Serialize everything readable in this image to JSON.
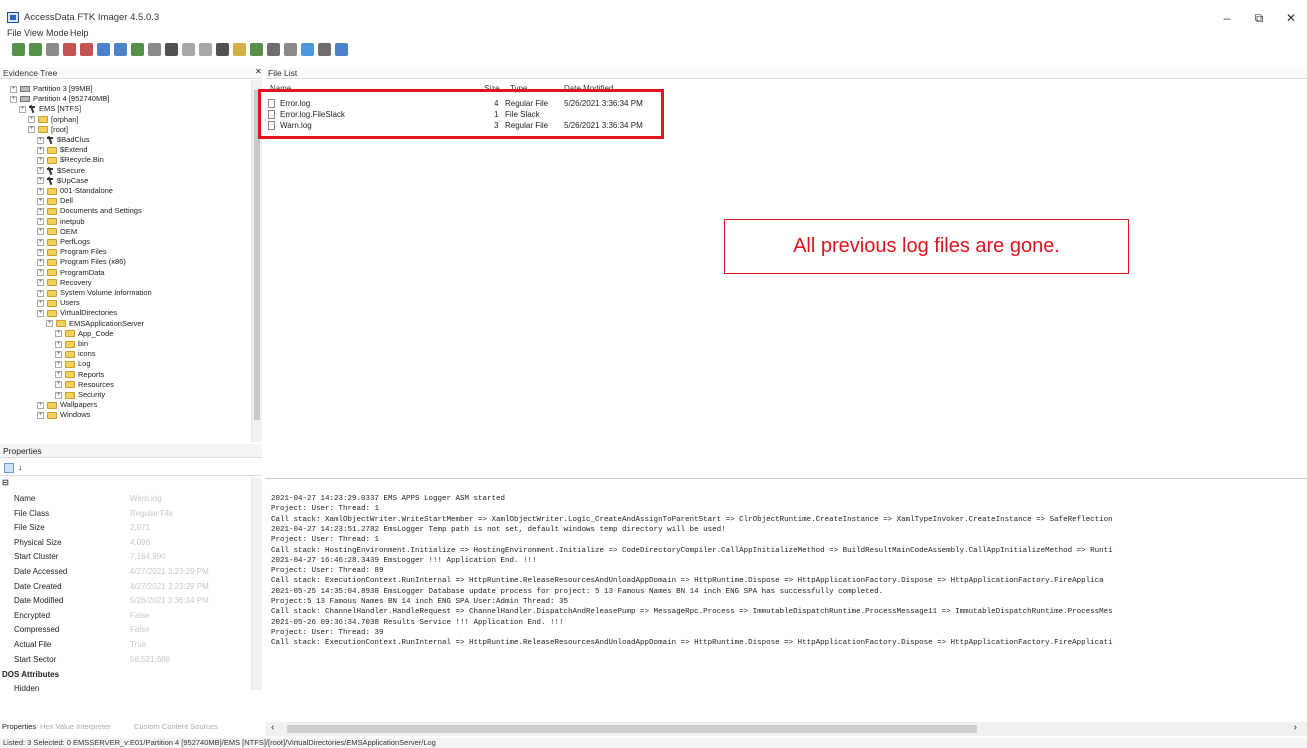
{
  "window": {
    "title": "AccessData FTK Imager 4.5.0.3",
    "minimize": "–",
    "restore": "⧉",
    "close": "✕"
  },
  "menu": [
    "File",
    "View",
    "Mode",
    "Help"
  ],
  "panels": {
    "evidence_tree_title": "Evidence Tree",
    "file_list_title": "File List",
    "properties_title": "Properties"
  },
  "tree": [
    {
      "label": "Partition 3 [99MB]",
      "kind": "drive",
      "indent": 0
    },
    {
      "label": "Partition 4 [952740MB]",
      "kind": "drive",
      "indent": 0
    },
    {
      "label": "EMS [NTFS]",
      "kind": "sys",
      "indent": 1
    },
    {
      "label": "[orphan]",
      "kind": "folder",
      "indent": 2
    },
    {
      "label": "[root]",
      "kind": "folder",
      "indent": 2
    },
    {
      "label": "$BadClus",
      "kind": "sys",
      "indent": 3
    },
    {
      "label": "$Extend",
      "kind": "folder",
      "indent": 3
    },
    {
      "label": "$Recycle.Bin",
      "kind": "folder",
      "indent": 3
    },
    {
      "label": "$Secure",
      "kind": "sys",
      "indent": 3
    },
    {
      "label": "$UpCase",
      "kind": "sys",
      "indent": 3
    },
    {
      "label": "001-Standalone",
      "kind": "folder",
      "indent": 3
    },
    {
      "label": "Dell",
      "kind": "folder",
      "indent": 3
    },
    {
      "label": "Documents and Settings",
      "kind": "folder",
      "indent": 3
    },
    {
      "label": "inetpub",
      "kind": "folder",
      "indent": 3
    },
    {
      "label": "OEM",
      "kind": "folder",
      "indent": 3
    },
    {
      "label": "PerfLogs",
      "kind": "folder",
      "indent": 3
    },
    {
      "label": "Program Files",
      "kind": "folder",
      "indent": 3
    },
    {
      "label": "Program Files (x86)",
      "kind": "folder",
      "indent": 3
    },
    {
      "label": "ProgramData",
      "kind": "folder",
      "indent": 3
    },
    {
      "label": "Recovery",
      "kind": "folder",
      "indent": 3
    },
    {
      "label": "System Volume Information",
      "kind": "folder",
      "indent": 3
    },
    {
      "label": "Users",
      "kind": "folder",
      "indent": 3
    },
    {
      "label": "VirtualDirectories",
      "kind": "folder",
      "indent": 3
    },
    {
      "label": "EMSApplicationServer",
      "kind": "folder",
      "indent": 4
    },
    {
      "label": "App_Code",
      "kind": "folder",
      "indent": 5
    },
    {
      "label": "bin",
      "kind": "folder",
      "indent": 5
    },
    {
      "label": "icons",
      "kind": "folder",
      "indent": 5
    },
    {
      "label": "Log",
      "kind": "folder",
      "indent": 5
    },
    {
      "label": "Reports",
      "kind": "folder",
      "indent": 5
    },
    {
      "label": "Resources",
      "kind": "folder",
      "indent": 5
    },
    {
      "label": "Security",
      "kind": "folder",
      "indent": 5
    },
    {
      "label": "Wallpapers",
      "kind": "folder",
      "indent": 3
    },
    {
      "label": "Windows",
      "kind": "folder",
      "indent": 3
    }
  ],
  "file_list": {
    "headers": {
      "name": "Name",
      "size": "Size",
      "type": "Type",
      "date": "Date Modified"
    },
    "rows": [
      {
        "name": "Error.log",
        "size": "4",
        "type": "Regular File",
        "date": "5/26/2021 3:36:34 PM"
      },
      {
        "name": "Error.log.FileSlack",
        "size": "1",
        "type": "File Slack",
        "date": ""
      },
      {
        "name": "Warn.log",
        "size": "3",
        "type": "Regular File",
        "date": "5/26/2021 3:36:34 PM"
      }
    ]
  },
  "annotation": "All previous log files are gone.",
  "properties": {
    "category": "",
    "rows": [
      {
        "name": "Name",
        "value": "Warn.log"
      },
      {
        "name": "File Class",
        "value": "Regular File"
      },
      {
        "name": "File Size",
        "value": "2,971"
      },
      {
        "name": "Physical Size",
        "value": "4,096"
      },
      {
        "name": "Start Cluster",
        "value": "7,164,990"
      },
      {
        "name": "Date Accessed",
        "value": "4/27/2021 3:23:29 PM"
      },
      {
        "name": "Date Created",
        "value": "4/27/2021 3:23:29 PM"
      },
      {
        "name": "Date Modified",
        "value": "5/26/2021 3:36:34 PM"
      },
      {
        "name": "Encrypted",
        "value": "False"
      },
      {
        "name": "Compressed",
        "value": "False"
      },
      {
        "name": "Actual File",
        "value": "True"
      },
      {
        "name": "Start Sector",
        "value": "58,521,688"
      }
    ],
    "dos_attributes": "DOS Attributes",
    "hidden": "Hidden",
    "tabs": [
      "Properties",
      "Hex Value Interpreter",
      "Custom Content Sources"
    ]
  },
  "log_lines": [
    "2021-04-27 14:23:29.0337 EMS APPS Logger ASM started",
    " Project: User: Thread: 1",
    " Call stack: XamlObjectWriter.WriteStartMember => XamlObjectWriter.Logic_CreateAndAssignToParentStart => ClrObjectRuntime.CreateInstance => XamlTypeInvoker.CreateInstance => SafeReflection",
    "2021-04-27 14:23:51.2782 EmsLogger Temp path is not set, default windows temp directory will be used!",
    " Project: User: Thread: 1",
    " Call stack: HostingEnvironment.Initialize => HostingEnvironment.Initialize => CodeDirectoryCompiler.CallAppInitializeMethod => BuildResultMainCodeAssembly.CallAppInitializeMethod => Runti",
    "2021-04-27 16:46:28.3439 EmsLogger !!! Application End. !!!",
    " Project: User: Thread: 89",
    " Call stack: ExecutionContext.RunInternal => HttpRuntime.ReleaseResourcesAndUnloadAppDomain => HttpRuntime.Dispose => HttpApplicationFactory.Dispose => HttpApplicationFactory.FireApplica",
    "2021-05-25 14:35:04.8938 EmsLogger Database update process for project: 5 13 Famous Names BN 14 inch ENG SPA has successfully completed.",
    " Project:5 13 Famous Names BN 14 inch ENG SPA User:Admin Thread: 35",
    " Call stack: ChannelHandler.HandleRequest => ChannelHandler.DispatchAndReleasePump => MessageRpc.Process => ImmutableDispatchRuntime.ProcessMessage11 => ImmutableDispatchRuntime.ProcessMes",
    "2021-05-26 09:36:34.7038 Results Service !!! Application End. !!!",
    " Project: User: Thread: 39",
    " Call stack: ExecutionContext.RunInternal => HttpRuntime.ReleaseResourcesAndUnloadAppDomain => HttpRuntime.Dispose => HttpApplicationFactory.Dispose => HttpApplicationFactory.FireApplicati"
  ],
  "status": "Listed: 3  Selected: 0  EMSSERVER_v:E01/Partition 4 [952740MB]/EMS [NTFS]/[root]/VirtualDirectories/EMSApplicationServer/Log",
  "colors": {
    "highlight": "#e0141e",
    "folder": "#f3cf5c"
  },
  "icons": {
    "toolbar": [
      "add-evidence-icon",
      "add-all-icon",
      "image-mounting-icon",
      "remove-evidence-icon",
      "remove-all-icon",
      "create-image-icon",
      "export-image-icon",
      "export-logical-icon",
      "capture-memory-icon",
      "obtain-protected-icon",
      "detect-encryption-icon",
      "export-files-icon",
      "export-hash-icon",
      "add-custom-icon",
      "manage-custom-icon",
      "view-icon",
      "view-text-icon",
      "auto-icon",
      "hex-icon",
      "help-icon"
    ]
  }
}
